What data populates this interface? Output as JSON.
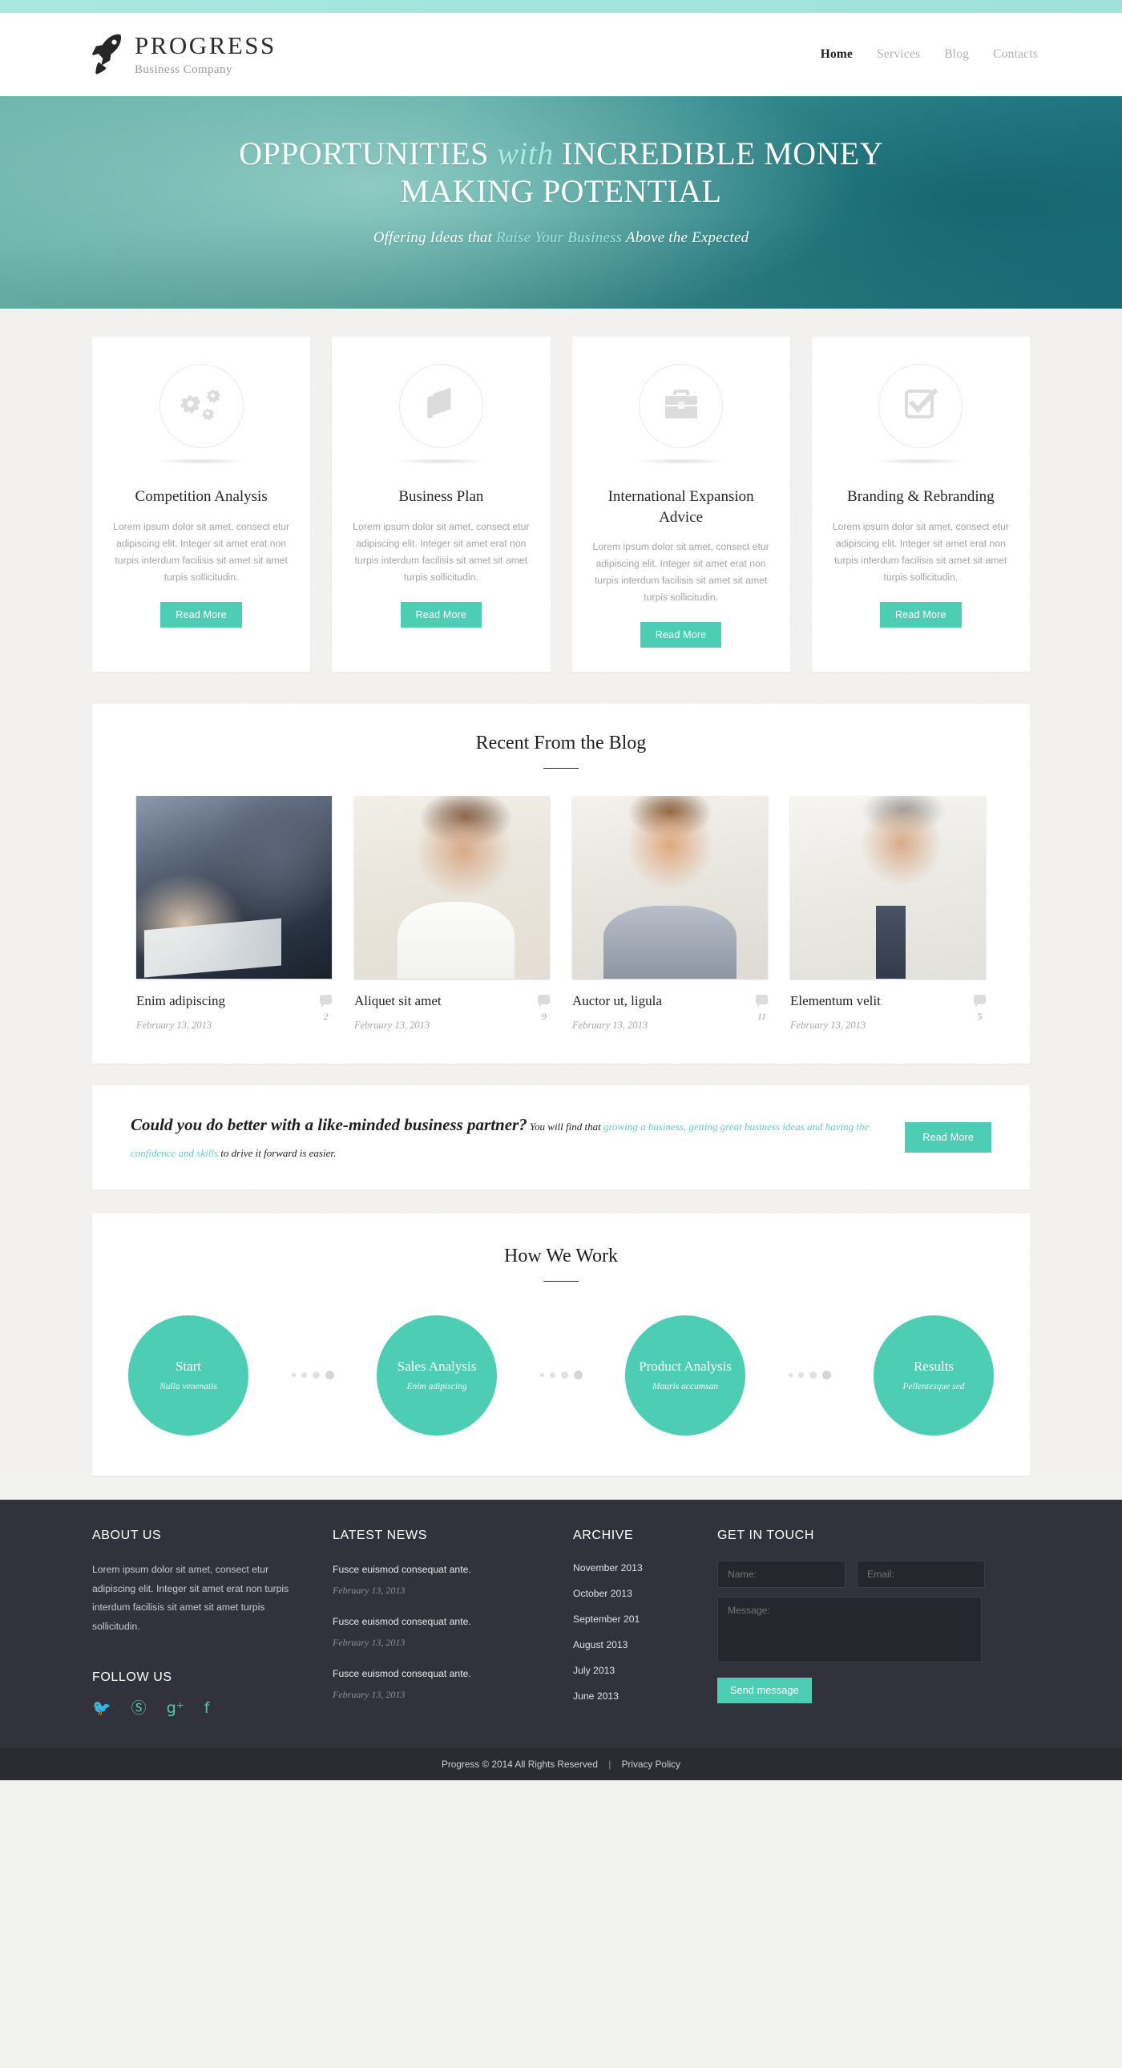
{
  "brand": {
    "title": "PROGRESS",
    "subtitle": "Business Company",
    "logo_icon": "rocket-icon"
  },
  "nav": {
    "items": [
      {
        "label": "Home",
        "active": true
      },
      {
        "label": "Services",
        "active": false
      },
      {
        "label": "Blog",
        "active": false
      },
      {
        "label": "Contacts",
        "active": false
      }
    ]
  },
  "hero": {
    "headline_part1": "OPPORTUNITIES ",
    "headline_em": "with",
    "headline_part2": " INCREDIBLE MONEY MAKING POTENTIAL",
    "sub_part1": "Offering Ideas that ",
    "sub_em": "Raise Your Business",
    "sub_part2": " Above the Expected"
  },
  "services": {
    "read_more": "Read More",
    "items": [
      {
        "icon": "gears-icon",
        "title": "Competition Analysis",
        "text": "Lorem ipsum dolor sit amet, consect etur adipiscing elit. Integer sit amet erat non turpis interdum facilisis sit amet sit amet turpis sollicitudin."
      },
      {
        "icon": "book-icon",
        "title": "Business Plan",
        "text": "Lorem ipsum dolor sit amet, consect etur adipiscing elit. Integer sit amet erat non turpis interdum facilisis sit amet sit amet turpis sollicitudin."
      },
      {
        "icon": "briefcase-icon",
        "title": "International Expansion Advice",
        "text": "Lorem ipsum dolor sit amet, consect etur adipiscing elit. Integer sit amet erat non turpis interdum facilisis sit amet sit amet turpis sollicitudin."
      },
      {
        "icon": "checkbox-icon",
        "title": "Branding & Rebranding",
        "text": "Lorem ipsum dolor sit amet, consect etur adipiscing elit. Integer sit amet erat non turpis interdum facilisis sit amet sit amet turpis sollicitudin."
      }
    ]
  },
  "blog": {
    "title": "Recent From the Blog",
    "posts": [
      {
        "title": "Enim adipiscing",
        "date": "February 13, 2013",
        "comments": "2",
        "image": "business-handshake-photo"
      },
      {
        "title": "Aliquet sit amet",
        "date": "February 13, 2013",
        "comments": "9",
        "image": "young-man-glasses-photo"
      },
      {
        "title": "Auctor ut, ligula",
        "date": "February 13, 2013",
        "comments": "11",
        "image": "smiling-man-suit-photo"
      },
      {
        "title": "Elementum velit",
        "date": "February 13, 2013",
        "comments": "5",
        "image": "grey-haired-man-tie-photo"
      }
    ]
  },
  "cta": {
    "lead": "Could you do better with a like-minded business partner?",
    "mid": " You will find that ",
    "highlight": "growing a business, getting great business ideas and having the confidence and skills",
    "end": " to drive it forward is easier.",
    "button": "Read More"
  },
  "how_we_work": {
    "title": "How We Work",
    "steps": [
      {
        "name": "Start",
        "sub": "Nulla venenatis"
      },
      {
        "name": "Sales Analysis",
        "sub": "Enim adipiscing"
      },
      {
        "name": "Product Analysis",
        "sub": "Mauris accumsan"
      },
      {
        "name": "Results",
        "sub": "Pellentesque sed"
      }
    ]
  },
  "footer": {
    "about": {
      "title": "ABOUT US",
      "text": "Lorem ipsum dolor sit amet, consect etur adipiscing elit. Integer sit amet erat non turpis interdum facilisis sit amet sit amet turpis sollicitudin."
    },
    "follow": {
      "title": "FOLLOW US",
      "socials": [
        {
          "icon": "twitter-icon",
          "glyph": "🐦"
        },
        {
          "icon": "skype-icon",
          "glyph": "Ⓢ"
        },
        {
          "icon": "google-plus-icon",
          "glyph": "g⁺"
        },
        {
          "icon": "facebook-icon",
          "glyph": "f"
        }
      ]
    },
    "latest_news": {
      "title": "LATEST NEWS",
      "items": [
        {
          "text": "Fusce euismod consequat ante.",
          "date": "February 13, 2013"
        },
        {
          "text": "Fusce euismod consequat ante.",
          "date": "February 13, 2013"
        },
        {
          "text": "Fusce euismod consequat ante.",
          "date": "February 13, 2013"
        }
      ]
    },
    "archive": {
      "title": "ARCHIVE",
      "items": [
        "November 2013",
        "October 2013",
        "September 201",
        "August 2013",
        "July 2013",
        "June 2013"
      ]
    },
    "get_in_touch": {
      "title": "GET IN TOUCH",
      "name_placeholder": "Name:",
      "email_placeholder": "Email:",
      "message_placeholder": "Message:",
      "send_label": "Send message"
    },
    "copyright": "Progress © 2014 All Rights Reserved",
    "separator": "|",
    "privacy": "Privacy Policy"
  },
  "colors": {
    "accent": "#4ccdb4",
    "accent_light": "#a9e8df",
    "hero_dark": "#1f7886",
    "footer_bg": "#32323c"
  }
}
